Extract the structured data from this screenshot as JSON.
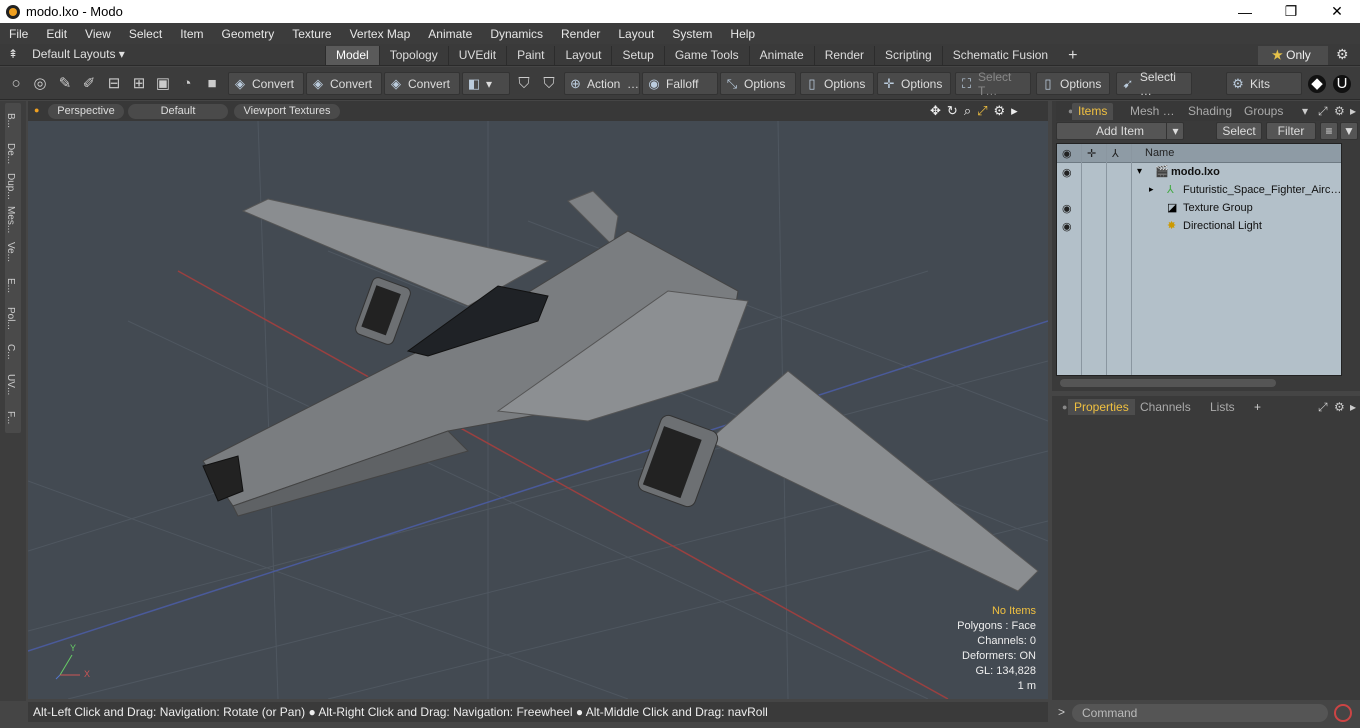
{
  "window": {
    "title": "modo.lxo - Modo",
    "controls": [
      "—",
      "❐",
      "✕"
    ]
  },
  "menu": [
    "File",
    "Edit",
    "View",
    "Select",
    "Item",
    "Geometry",
    "Texture",
    "Vertex Map",
    "Animate",
    "Dynamics",
    "Render",
    "Layout",
    "System",
    "Help"
  ],
  "layout_selector": "Default Layouts ▾",
  "tabs": [
    "Model",
    "Topology",
    "UVEdit",
    "Paint",
    "Layout",
    "Setup",
    "Game Tools",
    "Animate",
    "Render",
    "Scripting",
    "Schematic Fusion"
  ],
  "tabs_add": "+",
  "only_label": "Only",
  "toolbar": {
    "convert1": "Convert",
    "convert2": "Convert",
    "convert3": "Convert",
    "action": "Action",
    "action_more": "…",
    "falloff": "Falloff",
    "options1": "Options",
    "options2": "Options",
    "options3": "Options",
    "select_t": "Select T…",
    "options4": "Options",
    "selecti": "Selecti …",
    "kits": "Kits"
  },
  "left_strip": [
    "B...",
    "De...",
    "Dup...",
    "Mes...",
    "Ve...",
    "E...",
    "Pol...",
    "C...",
    "UV...",
    "F..."
  ],
  "viewport": {
    "header": {
      "perspective": "Perspective",
      "default": "Default",
      "textures": "Viewport Textures"
    },
    "hud": {
      "selection": "No Items",
      "polygons": "Polygons : Face",
      "channels": "Channels: 0",
      "deformers": "Deformers: ON",
      "gl": "GL: 134,828",
      "unit": "1 m"
    },
    "axis": {
      "y": "Y",
      "x": "X"
    }
  },
  "status": "Alt-Left Click and Drag: Navigation: Rotate (or Pan) ● Alt-Right Click and Drag: Navigation: Freewheel ● Alt-Middle Click and Drag: navRoll",
  "items_panel": {
    "tabs": [
      "Items",
      "Mesh …",
      "Shading",
      "Groups"
    ],
    "add_item": "Add Item",
    "select": "Select",
    "filter": "Filter",
    "column_name": "Name",
    "rows": [
      {
        "name": "modo.lxo"
      },
      {
        "name": "Futuristic_Space_Fighter_Airc…"
      },
      {
        "name": "Texture Group"
      },
      {
        "name": "Directional Light"
      }
    ]
  },
  "props_panel": {
    "tabs": [
      "Properties",
      "Channels",
      "Lists"
    ],
    "add": "+"
  },
  "command": {
    "prompt": ">",
    "placeholder": "Command"
  },
  "colors": {
    "accent": "#f0c040",
    "viewport_bg": "#434a52",
    "list_bg": "#b3c0c9"
  }
}
